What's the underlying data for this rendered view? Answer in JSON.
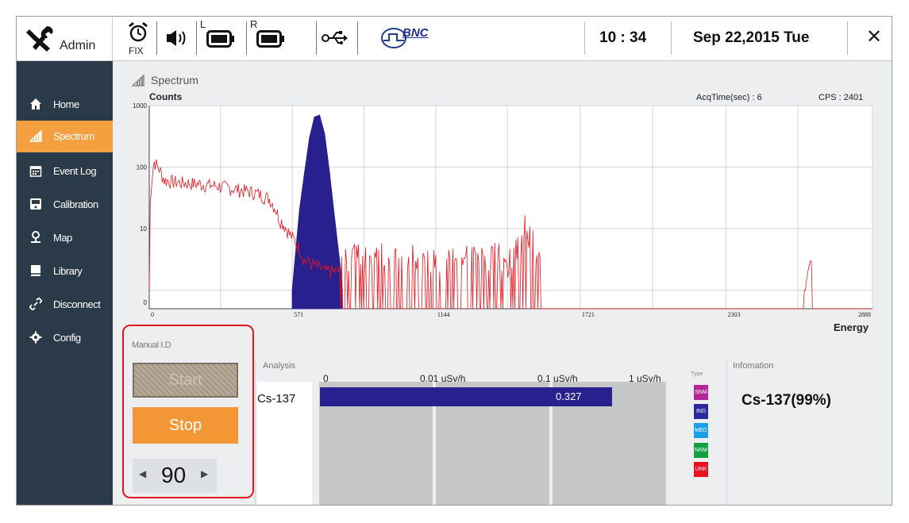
{
  "topbar": {
    "user_label": "Admin",
    "fix_label": "FIX",
    "battery_left_label": "L",
    "battery_right_label": "R",
    "bnc_label": "BNC",
    "time": "10 : 34",
    "date": "Sep 22,2015 Tue",
    "close_symbol": "✕",
    "icons": [
      "tools-icon",
      "alarm-clock-icon",
      "speaker-icon",
      "battery-left-icon",
      "battery-right-icon",
      "usb-icon",
      "bnc-pulse-icon",
      "close-icon"
    ]
  },
  "sidebar": {
    "items": [
      {
        "label": "Home",
        "icon": "home-icon",
        "active": false
      },
      {
        "label": "Spectrum",
        "icon": "spectrum-icon",
        "active": true
      },
      {
        "label": "Event Log",
        "icon": "calendar-icon",
        "active": false
      },
      {
        "label": "Calibration",
        "icon": "calibration-icon",
        "active": false
      },
      {
        "label": "Map",
        "icon": "map-pin-icon",
        "active": false
      },
      {
        "label": "Library",
        "icon": "library-icon",
        "active": false
      },
      {
        "label": "Disconnect",
        "icon": "disconnect-icon",
        "active": false
      },
      {
        "label": "Config",
        "icon": "gear-icon",
        "active": false
      }
    ],
    "background": "#2b3a48",
    "active_color": "#f4a040"
  },
  "spectrum": {
    "title": "Spectrum",
    "acq_time": "AcqTime(sec) : 6",
    "cps": "CPS : 2401"
  },
  "chart_data": {
    "type": "area",
    "ylabel": "Counts",
    "xlabel": "Energy",
    "y_scale": "log",
    "y_ticks": [
      "1000",
      "100",
      "10",
      "0"
    ],
    "x_ticks": [
      "0",
      "571",
      "1144",
      "1721",
      "2303",
      "2888"
    ],
    "xlim": [
      0,
      2888
    ],
    "ylim": [
      0,
      1000
    ],
    "grid": true,
    "series": [
      {
        "style": "red line",
        "color": "#e8141d",
        "x": [
          0,
          20,
          60,
          120,
          200,
          280,
          360,
          420,
          480,
          520,
          560,
          620,
          700,
          750,
          800,
          900,
          1000,
          1100,
          1200,
          1300,
          1400,
          1450,
          1480,
          1500,
          1520,
          1550,
          1700,
          2000,
          2300,
          2620,
          2640,
          2700,
          2888
        ],
        "values": [
          1,
          120,
          60,
          55,
          52,
          48,
          42,
          38,
          30,
          14,
          8,
          3,
          2,
          2,
          2,
          2,
          2,
          2,
          2,
          2,
          2,
          3,
          6,
          14,
          8,
          3,
          1,
          1,
          1,
          1,
          3,
          1,
          1
        ]
      },
      {
        "style": "blue filled peak",
        "color": "#28208e",
        "x": [
          571,
          600,
          620,
          640,
          660,
          680,
          700,
          720,
          740,
          760,
          771
        ],
        "values": [
          1,
          20,
          80,
          300,
          650,
          700,
          350,
          80,
          15,
          3,
          1
        ]
      }
    ]
  },
  "manual_id": {
    "label": "Manual I.D",
    "start_label": "Start",
    "stop_label": "Stop",
    "stepper_value": "90",
    "left_arrow": "◀",
    "right_arrow": "▶"
  },
  "analysis": {
    "label": "Analysis",
    "isotope": "Cs-137",
    "scale": [
      "0",
      "0.01 uSv/h",
      "0.1 uSv/h",
      "1 uSv/h"
    ],
    "dose_value": "0.327",
    "dose_bar_fraction": 0.84,
    "bar_color": "#28208e"
  },
  "types": {
    "label": "Type",
    "items": [
      {
        "label": "SNM",
        "color": "#b02898"
      },
      {
        "label": "IND",
        "color": "#2a2a9e"
      },
      {
        "label": "MED",
        "color": "#1aa0e8"
      },
      {
        "label": "NRM",
        "color": "#12a040"
      },
      {
        "label": "UNK",
        "color": "#e8141d"
      }
    ]
  },
  "information": {
    "label": "Infomation",
    "result": "Cs-137(99%)"
  }
}
